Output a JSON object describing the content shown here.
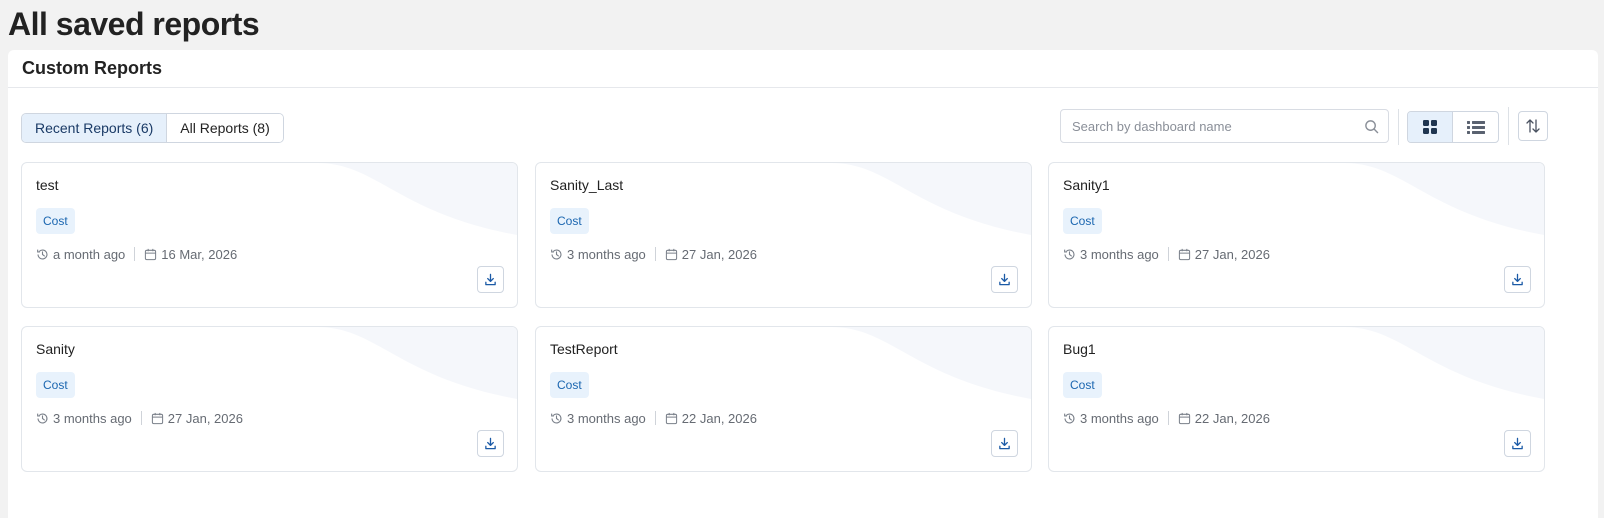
{
  "page": {
    "title": "All saved reports"
  },
  "panel": {
    "title": "Custom Reports"
  },
  "tabs": [
    {
      "label": "Recent Reports (6)",
      "active": true
    },
    {
      "label": "All Reports (8)",
      "active": false
    }
  ],
  "search": {
    "placeholder": "Search by dashboard name",
    "value": "",
    "icon": "search-icon"
  },
  "view": {
    "active": "grid",
    "options": [
      "grid-view-icon",
      "list-view-icon"
    ]
  },
  "sort": {
    "icon": "sort-icon"
  },
  "colors": {
    "accent": "#1b66b0",
    "active_bg": "#e6f0fb",
    "badge_bg": "#e8f2fc"
  },
  "reports": [
    {
      "name": "test",
      "tag": "Cost",
      "relative": "a month ago",
      "date": "16 Mar, 2026"
    },
    {
      "name": "Sanity_Last",
      "tag": "Cost",
      "relative": "3 months ago",
      "date": "27 Jan, 2026"
    },
    {
      "name": "Sanity1",
      "tag": "Cost",
      "relative": "3 months ago",
      "date": "27 Jan, 2026"
    },
    {
      "name": "Sanity",
      "tag": "Cost",
      "relative": "3 months ago",
      "date": "27 Jan, 2026"
    },
    {
      "name": "TestReport",
      "tag": "Cost",
      "relative": "3 months ago",
      "date": "22 Jan, 2026"
    },
    {
      "name": "Bug1",
      "tag": "Cost",
      "relative": "3 months ago",
      "date": "22 Jan, 2026"
    }
  ]
}
